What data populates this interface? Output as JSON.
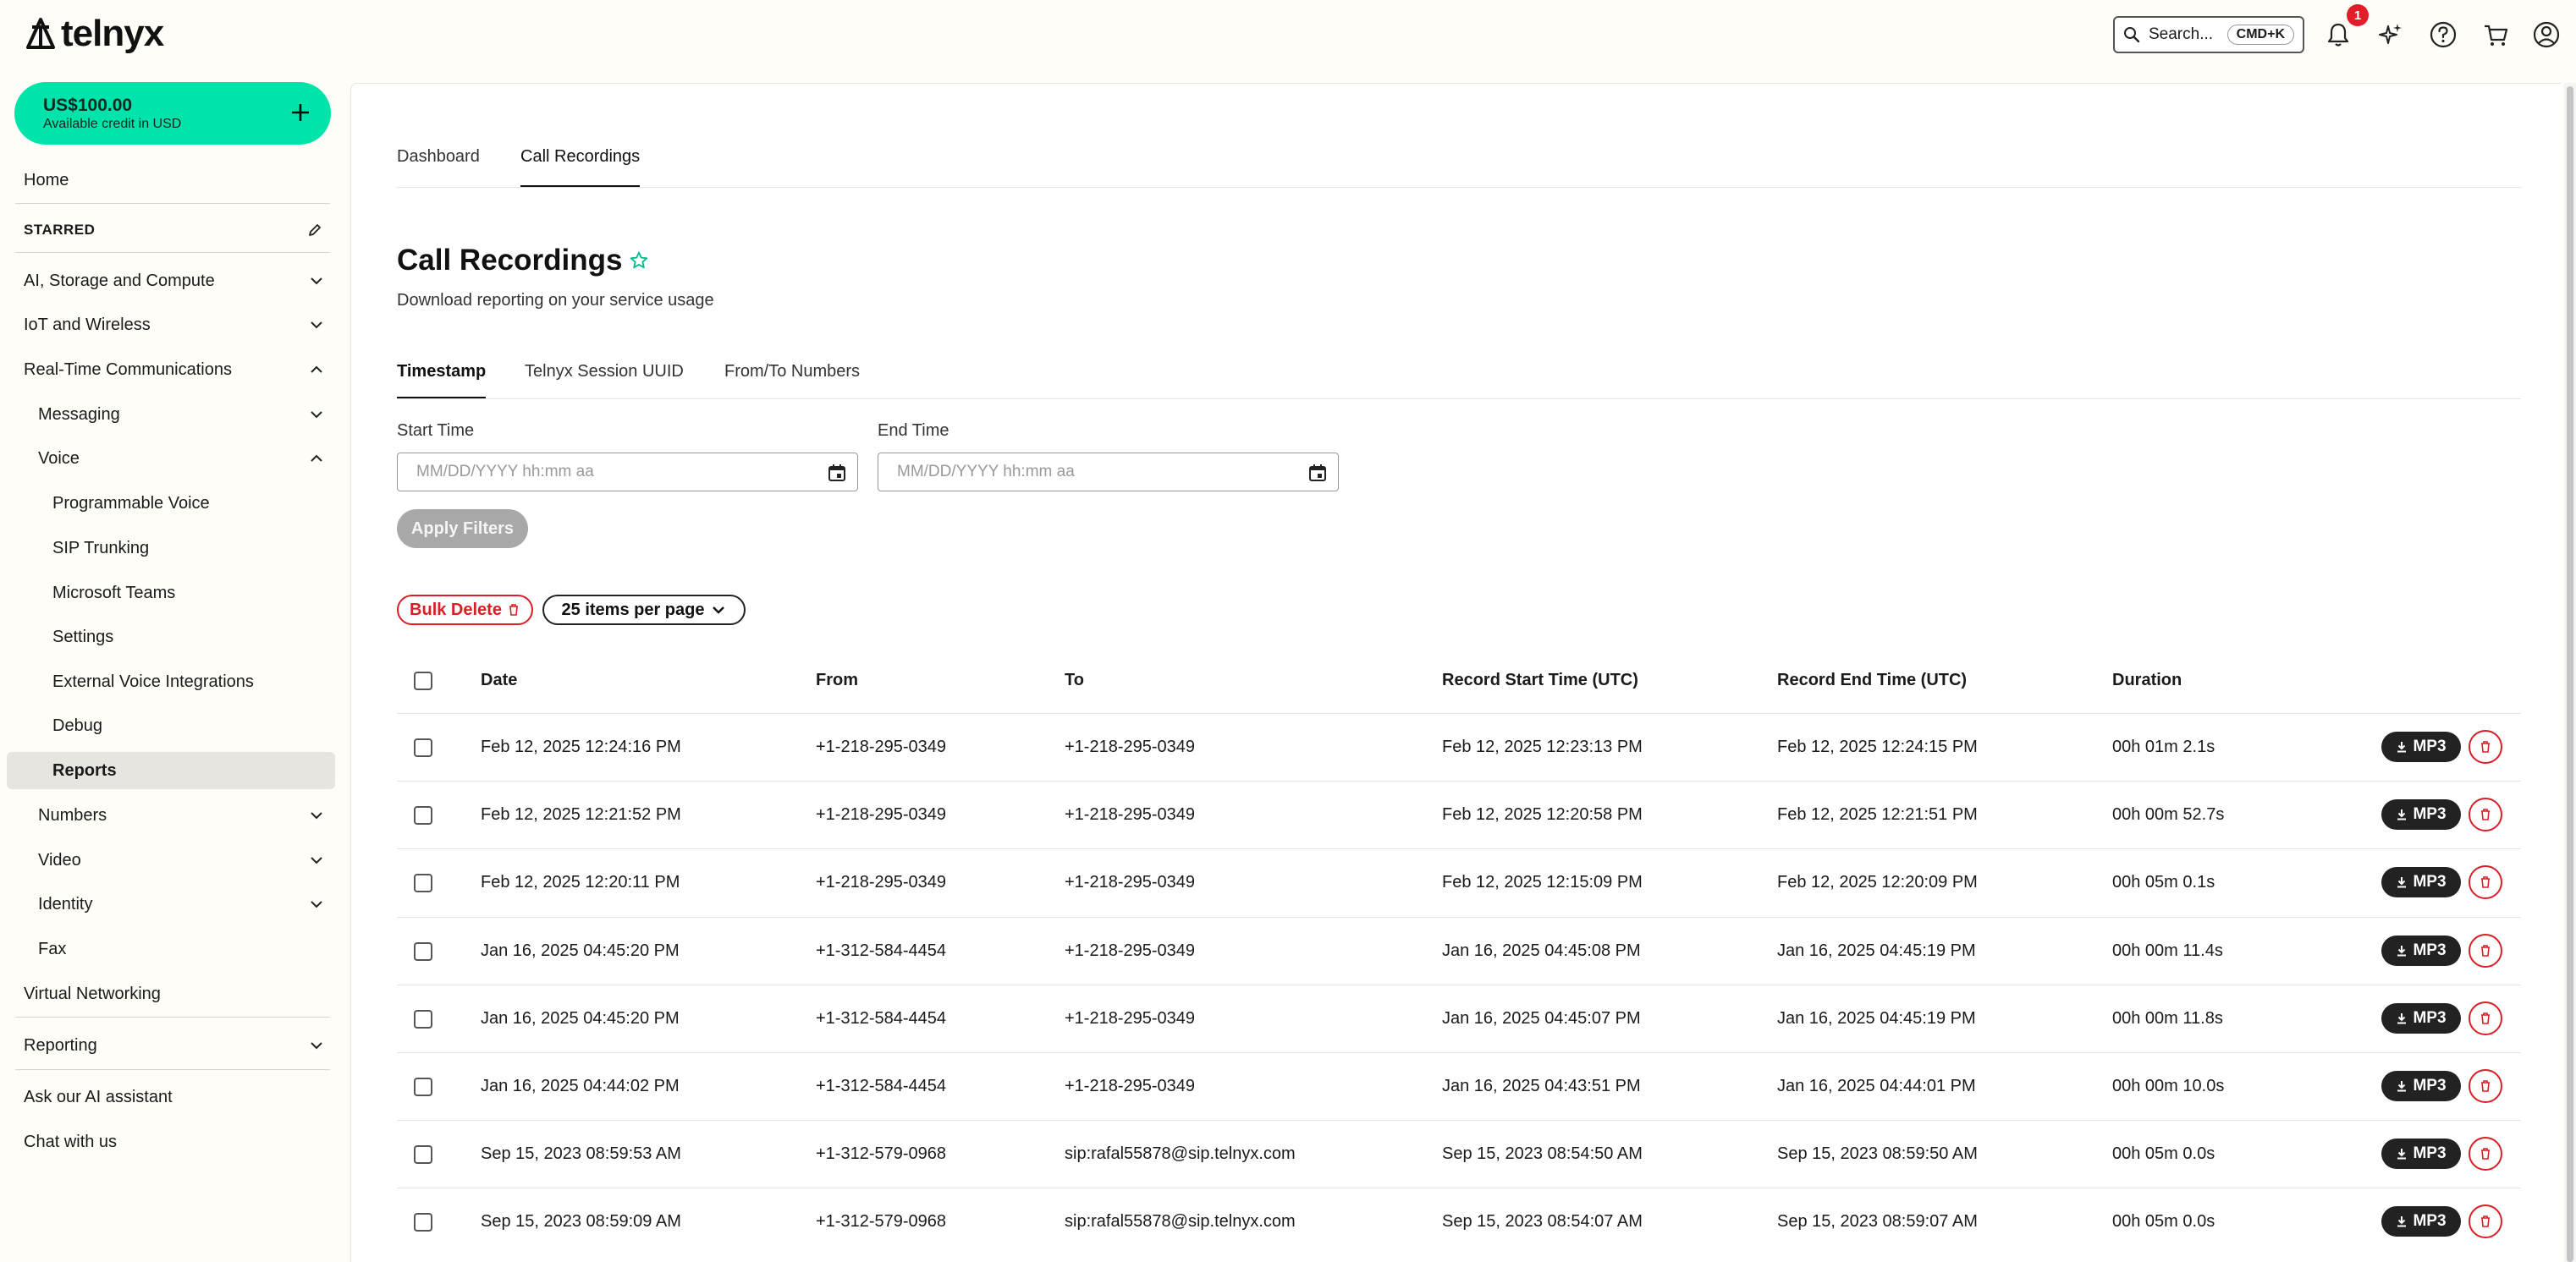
{
  "brand": {
    "name": "telnyx",
    "accent": "#00e3aa",
    "danger": "#d91f26"
  },
  "header": {
    "search_placeholder": "Search...",
    "search_shortcut": "CMD+K",
    "notification_count": "1"
  },
  "sidebar": {
    "credit_amount": "US$100.00",
    "credit_label": "Available credit in USD",
    "home": "Home",
    "starred": "STARRED",
    "ai_storage": "AI, Storage and Compute",
    "iot": "IoT and Wireless",
    "rtc": "Real-Time Communications",
    "messaging": "Messaging",
    "voice": "Voice",
    "programmable_voice": "Programmable Voice",
    "sip_trunking": "SIP Trunking",
    "microsoft_teams": "Microsoft Teams",
    "settings": "Settings",
    "external_voice": "External Voice Integrations",
    "debug": "Debug",
    "reports": "Reports",
    "numbers": "Numbers",
    "video": "Video",
    "identity": "Identity",
    "fax": "Fax",
    "virtual_networking": "Virtual Networking",
    "reporting": "Reporting",
    "ask_ai": "Ask our AI assistant",
    "chat": "Chat with us"
  },
  "tabs": {
    "dashboard": "Dashboard",
    "call_recordings": "Call Recordings"
  },
  "page": {
    "title": "Call Recordings",
    "subtitle": "Download reporting on your service usage"
  },
  "filter_tabs": {
    "timestamp": "Timestamp",
    "session_uuid": "Telnyx Session UUID",
    "from_to": "From/To Numbers"
  },
  "filters": {
    "start_label": "Start Time",
    "end_label": "End Time",
    "start_placeholder": "MM/DD/YYYY hh:mm aa",
    "end_placeholder": "MM/DD/YYYY hh:mm aa",
    "apply": "Apply Filters"
  },
  "toolbar": {
    "bulk_delete": "Bulk Delete",
    "per_page": "25 items per page"
  },
  "table": {
    "headers": {
      "date": "Date",
      "from": "From",
      "to": "To",
      "start": "Record Start Time (UTC)",
      "end": "Record End Time (UTC)",
      "duration": "Duration"
    },
    "download_label": "MP3",
    "rows": [
      {
        "date": "Feb 12, 2025 12:24:16 PM",
        "from": "+1-218-295-0349",
        "to": "+1-218-295-0349",
        "start": "Feb 12, 2025 12:23:13 PM",
        "end": "Feb 12, 2025 12:24:15 PM",
        "duration": "00h 01m 2.1s"
      },
      {
        "date": "Feb 12, 2025 12:21:52 PM",
        "from": "+1-218-295-0349",
        "to": "+1-218-295-0349",
        "start": "Feb 12, 2025 12:20:58 PM",
        "end": "Feb 12, 2025 12:21:51 PM",
        "duration": "00h 00m 52.7s"
      },
      {
        "date": "Feb 12, 2025 12:20:11 PM",
        "from": "+1-218-295-0349",
        "to": "+1-218-295-0349",
        "start": "Feb 12, 2025 12:15:09 PM",
        "end": "Feb 12, 2025 12:20:09 PM",
        "duration": "00h 05m 0.1s"
      },
      {
        "date": "Jan 16, 2025 04:45:20 PM",
        "from": "+1-312-584-4454",
        "to": "+1-218-295-0349",
        "start": "Jan 16, 2025 04:45:08 PM",
        "end": "Jan 16, 2025 04:45:19 PM",
        "duration": "00h 00m 11.4s"
      },
      {
        "date": "Jan 16, 2025 04:45:20 PM",
        "from": "+1-312-584-4454",
        "to": "+1-218-295-0349",
        "start": "Jan 16, 2025 04:45:07 PM",
        "end": "Jan 16, 2025 04:45:19 PM",
        "duration": "00h 00m 11.8s"
      },
      {
        "date": "Jan 16, 2025 04:44:02 PM",
        "from": "+1-312-584-4454",
        "to": "+1-218-295-0349",
        "start": "Jan 16, 2025 04:43:51 PM",
        "end": "Jan 16, 2025 04:44:01 PM",
        "duration": "00h 00m 10.0s"
      },
      {
        "date": "Sep 15, 2023 08:59:53 AM",
        "from": "+1-312-579-0968",
        "to": "sip:rafal55878@sip.telnyx.com",
        "start": "Sep 15, 2023 08:54:50 AM",
        "end": "Sep 15, 2023 08:59:50 AM",
        "duration": "00h 05m 0.0s"
      },
      {
        "date": "Sep 15, 2023 08:59:09 AM",
        "from": "+1-312-579-0968",
        "to": "sip:rafal55878@sip.telnyx.com",
        "start": "Sep 15, 2023 08:54:07 AM",
        "end": "Sep 15, 2023 08:59:07 AM",
        "duration": "00h 05m 0.0s"
      }
    ]
  }
}
